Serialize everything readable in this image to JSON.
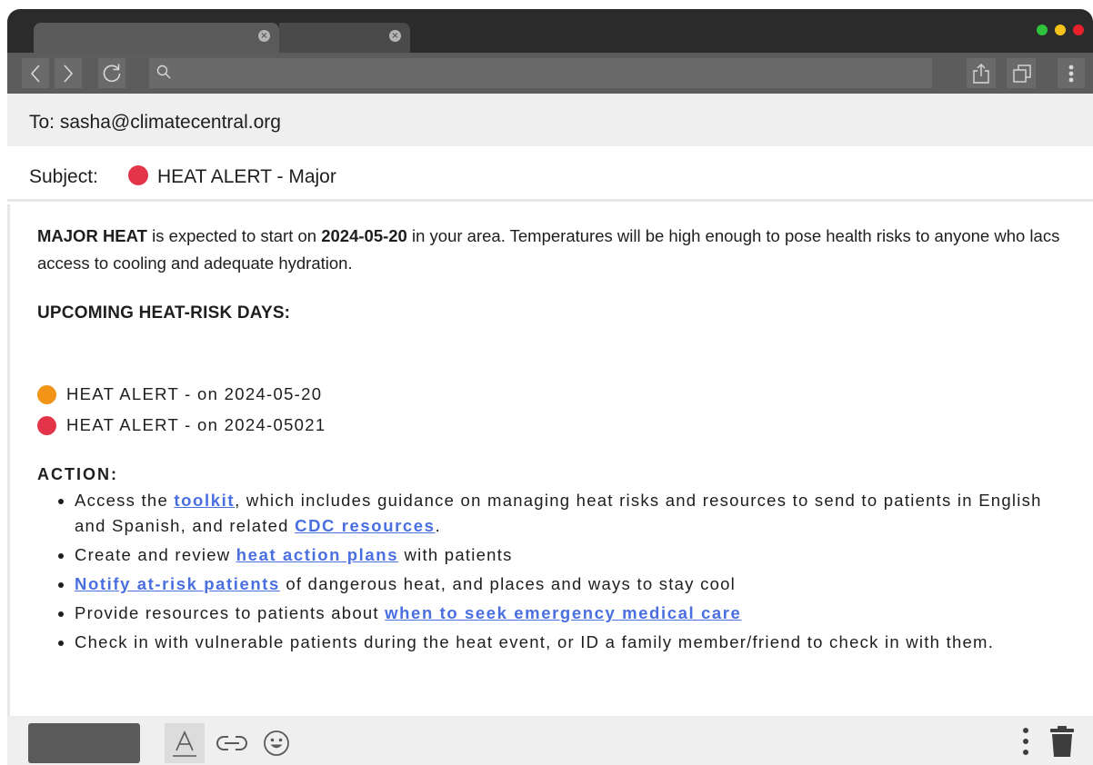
{
  "browser": {
    "tabs": [
      {
        "label": ""
      },
      {
        "label": ""
      }
    ],
    "window_dots": [
      "#2fc23f",
      "#f4c218",
      "#e8202a"
    ],
    "url": ""
  },
  "email": {
    "to": "To: sasha@climatecentral.org",
    "subject_label": "Subject:",
    "subject_text": "HEAT ALERT - Major",
    "subject_dot_color": "#e3344a"
  },
  "body": {
    "intro_bold_1": "MAJOR HEAT",
    "intro_text_1": " is expected to start on ",
    "intro_bold_2": "2024-05-20",
    "intro_text_2": " in your area. Temperatures will be high enough to pose health risks to anyone who lacs access to cooling and adequate hydration.",
    "upcoming_title": "UPCOMING HEAT-RISK DAYS:",
    "risk_days": [
      {
        "label": "HEAT ALERT - on 2024-05-20",
        "color": "#f29418"
      },
      {
        "label": "HEAT ALERT - on 2024-05021",
        "color": "#e3344a"
      }
    ],
    "action_title": "ACTION:",
    "actions": {
      "a1_pre": "Access the ",
      "a1_link1": "toolkit",
      "a1_mid": ", which includes guidance on managing heat risks and resources to send to patients in English and Spanish, and related ",
      "a1_link2": "CDC resources",
      "a1_post": ".",
      "a2_pre": "Create and review ",
      "a2_link": "heat action plans",
      "a2_post": " with patients",
      "a3_link": "Notify at-risk patients",
      "a3_post": " of dangerous heat, and places and ways to stay cool",
      "a4_pre": "Provide resources to patients about ",
      "a4_link": "when to seek emergency medical care",
      "a5_text": "Check in with vulnerable patients during the heat event, or ID a family member/friend to check in with them."
    }
  },
  "icons": {
    "back": "chevron-left-icon",
    "forward": "chevron-right-icon",
    "reload": "reload-icon",
    "search": "search-icon",
    "share": "share-icon",
    "tabs": "tabs-icon",
    "menu": "kebab-menu-icon",
    "format": "text-format-icon",
    "link": "link-icon",
    "emoji": "emoji-icon",
    "more": "more-vertical-icon",
    "trash": "trash-icon"
  }
}
